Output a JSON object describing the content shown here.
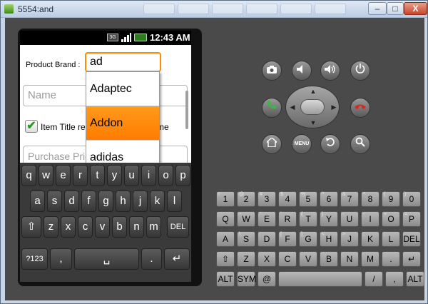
{
  "window": {
    "title": "5554:and",
    "minimize": "–",
    "maximize": "□",
    "close": "X"
  },
  "status_bar": {
    "network": "3G",
    "time": "12:43 AM"
  },
  "form": {
    "brand_label": "Product Brand :",
    "brand_value": "ad",
    "name_placeholder": "Name",
    "checkbox_label_visible": "Item Title re",
    "checkbox_label_suffix": "me",
    "purchase_placeholder": "Purchase Pric"
  },
  "dropdown": {
    "items": [
      "Adaptec",
      "Addon",
      "adidas"
    ],
    "selected": "Addon"
  },
  "keyboard": {
    "row1": [
      "q",
      "w",
      "e",
      "r",
      "t",
      "y",
      "u",
      "i",
      "o",
      "p"
    ],
    "row2": [
      "a",
      "s",
      "d",
      "f",
      "g",
      "h",
      "j",
      "k",
      "l"
    ],
    "row3": [
      "⇧",
      "z",
      "x",
      "c",
      "v",
      "b",
      "n",
      "m",
      "DEL"
    ],
    "row4": [
      "?123",
      ",",
      "␣",
      ".",
      "↵"
    ]
  },
  "hw_keyboard": {
    "row1": [
      "1",
      "2",
      "3",
      "4",
      "5",
      "6",
      "7",
      "8",
      "9",
      "0"
    ],
    "row1_sub": [
      "!",
      "@",
      "#",
      "$",
      "%",
      "^",
      "&",
      "*",
      "(",
      ")"
    ],
    "row2": [
      "Q",
      "W",
      "E",
      "R",
      "T",
      "Y",
      "U",
      "I",
      "O",
      "P"
    ],
    "row2_sub": [
      "",
      "~",
      "\"",
      "`",
      "{",
      "}",
      "-",
      "-",
      "+",
      "="
    ],
    "row3": [
      "A",
      "S",
      "D",
      "F",
      "G",
      "H",
      "J",
      "K",
      "L",
      "DEL"
    ],
    "row3_sub": [
      "",
      "\\",
      "",
      "[",
      "]",
      "<",
      ">",
      ";",
      ":",
      ""
    ],
    "row4": [
      "⇧",
      "Z",
      "X",
      "C",
      "V",
      "B",
      "N",
      "M",
      ".",
      "↵"
    ],
    "row5": [
      "ALT",
      "SYM",
      "@",
      "",
      "/",
      ",",
      "ALT"
    ]
  },
  "controls": {
    "menu": "MENU"
  },
  "colors": {
    "accent_orange": "#ff8c00",
    "emulator_bg": "#4a4a4a",
    "check_green": "#2a9a1c"
  }
}
